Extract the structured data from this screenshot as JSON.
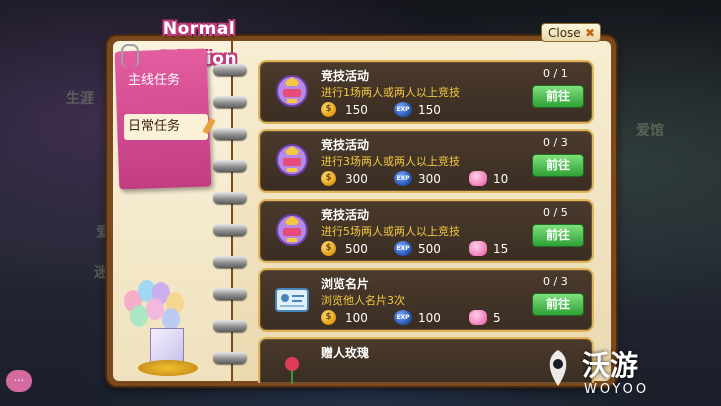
{
  "window": {
    "title": "Normal Mission",
    "close_label": "Close"
  },
  "tabs": [
    {
      "label": "主线任务",
      "active": false
    },
    {
      "label": "日常任务",
      "active": true
    }
  ],
  "missions": [
    {
      "title": "竞技活动",
      "desc": "进行1场两人或两人以上竞技",
      "progress": "0 / 1",
      "button": "前往",
      "coins": "150",
      "exp": "150",
      "hearts": null,
      "icon": "trophy-badge-icon"
    },
    {
      "title": "竞技活动",
      "desc": "进行3场两人或两人以上竞技",
      "progress": "0 / 3",
      "button": "前往",
      "coins": "300",
      "exp": "300",
      "hearts": "10",
      "icon": "trophy-badge-icon"
    },
    {
      "title": "竞技活动",
      "desc": "进行5场两人或两人以上竞技",
      "progress": "0 / 5",
      "button": "前往",
      "coins": "500",
      "exp": "500",
      "hearts": "15",
      "icon": "trophy-badge-icon"
    },
    {
      "title": "浏览名片",
      "desc": "浏览他人名片3次",
      "progress": "0 / 3",
      "button": "前往",
      "coins": "100",
      "exp": "100",
      "hearts": "5",
      "icon": "name-card-icon"
    },
    {
      "title": "赠人玫瑰",
      "desc": "",
      "progress": "",
      "button": "",
      "coins": null,
      "exp": null,
      "hearts": null,
      "icon": "rose-icon"
    }
  ],
  "reward_icons": {
    "coin": "coin-icon",
    "exp": "exp-icon",
    "heart": "heart-icon"
  },
  "exp_icon_text": "EXP",
  "background_signs": [
    "生涯",
    "爱情",
    "迷",
    "爱馆"
  ],
  "watermark": {
    "cn": "沃游",
    "en": "WOYOO"
  },
  "colors": {
    "tab_pink": "#d24a90",
    "card_border": "#e0b55a",
    "button_green": "#3fb344",
    "desc_yellow": "#f4c93f"
  }
}
